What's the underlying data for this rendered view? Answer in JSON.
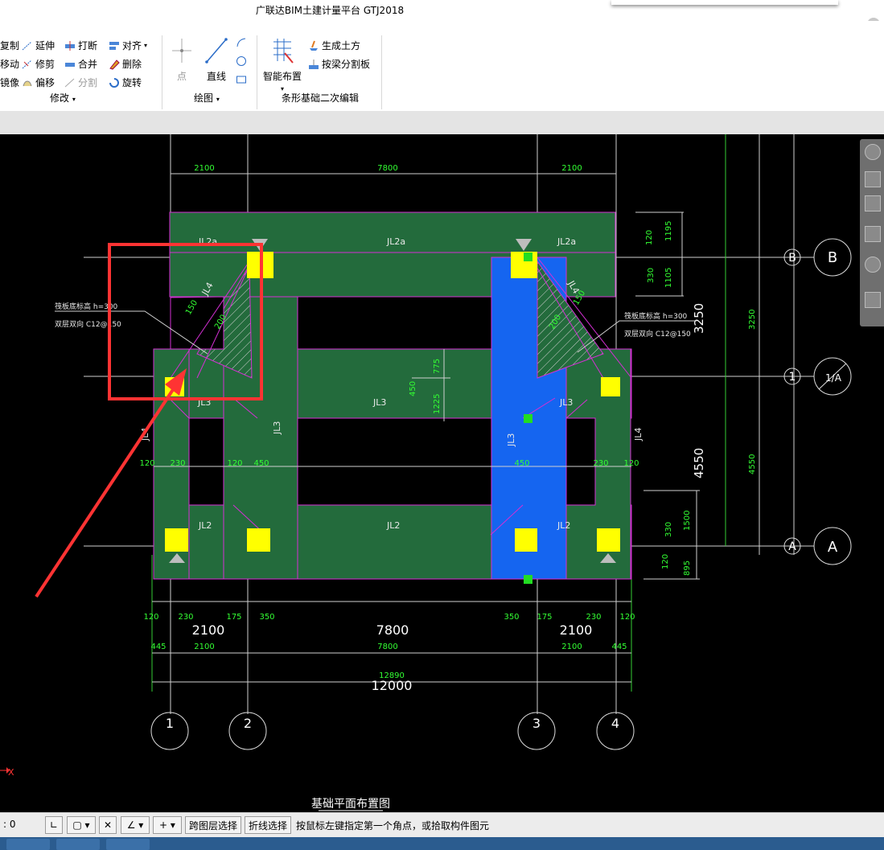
{
  "app": {
    "title": "广联达BIM土建计量平台 GTJ2018"
  },
  "ribbon": {
    "modify": {
      "copy": "复制",
      "extend": "延伸",
      "break": "打断",
      "align": "对齐",
      "move": "移动",
      "trim": "修剪",
      "merge": "合并",
      "delete": "删除",
      "mirror": "镜像",
      "offset": "偏移",
      "split": "分割",
      "rotate": "旋转",
      "group_label": "修改"
    },
    "draw": {
      "point": "点",
      "line": "直线",
      "group_label": "绘图"
    },
    "strip": {
      "smart": "智能布置",
      "earthwork": "生成土方",
      "split_by_beam": "按梁分割板",
      "group_label": "条形基础二次编辑"
    }
  },
  "drawing": {
    "title": "基础平面布置图",
    "top_dims": [
      "2100",
      "7800",
      "2100"
    ],
    "beams": {
      "jl2a": "JL2a",
      "jl3": "JL3",
      "jl2": "JL2",
      "jl4": "JL4"
    },
    "right_dims_small": [
      "120",
      "1195",
      "330",
      "1105"
    ],
    "right_dims_big": [
      "3250",
      "4550"
    ],
    "right_dims_total": "3250",
    "right_dims_total2": "4550",
    "right_bottom_dims": [
      "330",
      "1500",
      "120",
      "895"
    ],
    "center_dims": [
      "775",
      "450",
      "1225"
    ],
    "mid_dims": [
      "120",
      "230",
      "120",
      "450",
      "450",
      "230",
      "120"
    ],
    "bottom_small": [
      "120",
      "230",
      "175",
      "350",
      "350",
      "175",
      "230",
      "120"
    ],
    "bottom_big": [
      "2100",
      "7800",
      "2100"
    ],
    "bottom_green": [
      "445",
      "2100",
      "7800",
      "2100",
      "445"
    ],
    "total_green": "12890",
    "total_white": "12000",
    "notes_left": [
      "筏板底标高 h=300",
      "双层双向 C12@150"
    ],
    "notes_right": [
      "筏板底标高 h=300",
      "双层双向 C12@150"
    ],
    "diag_dims": [
      "150",
      "200"
    ],
    "axes_bottom": [
      "1",
      "2",
      "3",
      "4"
    ],
    "axes_right": [
      "B",
      "1",
      "A"
    ],
    "axis_circle_right": [
      "B",
      "1/A",
      "A"
    ],
    "x_marker": "X"
  },
  "status": {
    "coord": ": 0",
    "layer_select": "跨图层选择",
    "polyline_select": "折线选择",
    "prompt": "按鼠标左键指定第一个角点，或拾取构件图元"
  },
  "colors": {
    "beam": "#236b3c",
    "selected": "#1565f0",
    "column": "#ffff00",
    "highlight": "#ff3333",
    "dim": "#33ff33"
  }
}
